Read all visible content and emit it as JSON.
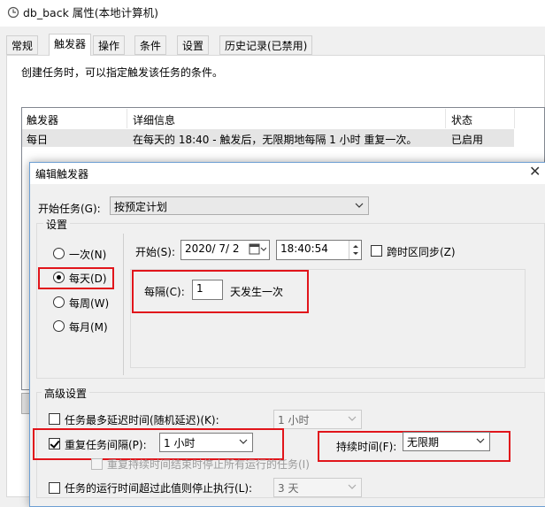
{
  "window": {
    "title": "db_back 属性(本地计算机)"
  },
  "tabs": [
    {
      "label": "常规"
    },
    {
      "label": "触发器"
    },
    {
      "label": "操作"
    },
    {
      "label": "条件"
    },
    {
      "label": "设置"
    },
    {
      "label": "历史记录(已禁用)"
    }
  ],
  "triggers_panel": {
    "description": "创建任务时，可以指定触发该任务的条件。",
    "columns": [
      "触发器",
      "详细信息",
      "状态"
    ],
    "rows": [
      {
        "trigger": "每日",
        "details": "在每天的 18:40 - 触发后，无限期地每隔 1 小时 重复一次。",
        "status": "已启用"
      }
    ]
  },
  "edit_dialog": {
    "title": "编辑触发器",
    "close_glyph": "✕",
    "begin_task_label": "开始任务(G):",
    "begin_task_value": "按预定计划",
    "settings_label": "设置",
    "schedule_options": [
      {
        "label": "一次(N)",
        "selected": false
      },
      {
        "label": "每天(D)",
        "selected": true
      },
      {
        "label": "每周(W)",
        "selected": false
      },
      {
        "label": "每月(M)",
        "selected": false
      }
    ],
    "start_label": "开始(S):",
    "start_date": "2020/ 7/ 2",
    "start_time": "18:40:54",
    "sync_timezones_label": "跨时区同步(Z)",
    "sync_timezones_checked": false,
    "recur_label": "每隔(C):",
    "recur_value": "1",
    "recur_suffix": "天发生一次",
    "advanced_label": "高级设置",
    "delay_label": "任务最多延迟时间(随机延迟)(K):",
    "delay_checked": false,
    "delay_value": "1 小时",
    "repeat_label": "重复任务间隔(P):",
    "repeat_checked": true,
    "repeat_value": "1 小时",
    "duration_label": "持续时间(F):",
    "duration_value": "无限期",
    "stop_at_end_label": "重复持续时间结束时停止所有运行的任务(I)",
    "stop_at_end_checked": false,
    "stop_longer_label": "任务的运行时间超过此值则停止执行(L):",
    "stop_longer_checked": false,
    "stop_longer_value": "3 天"
  },
  "colors": {
    "highlight_red": "#e1151b",
    "dialog_border": "#6d9fd3"
  },
  "icons": [
    "clock-icon",
    "calendar-dropdown-icon",
    "spin-up-icon",
    "spin-down-icon",
    "chevron-down-icon",
    "close-icon"
  ]
}
